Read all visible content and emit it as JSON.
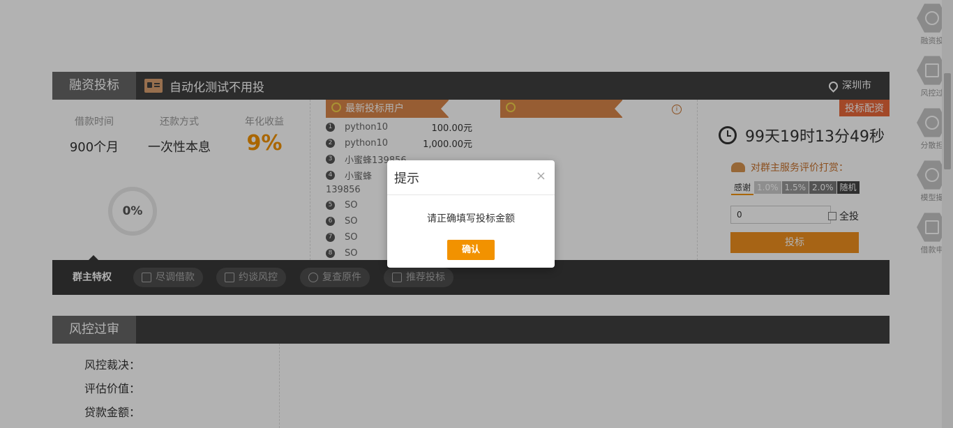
{
  "loan": {
    "tab": "融资投标",
    "title": "自动化测试不用投",
    "city": "深圳市",
    "term_label": "借款时间",
    "term_value": "900个月",
    "repay_label": "还款方式",
    "repay_value": "一次性本息",
    "rate_label": "年化收益",
    "rate_value": "9%",
    "progress": "0%",
    "progress_fraction": 0
  },
  "bidders": {
    "title": "最新投标用户",
    "rows": [
      {
        "n": "1",
        "name": "python10",
        "amount": "100.00元"
      },
      {
        "n": "2",
        "name": "python10",
        "amount": "1,000.00元"
      },
      {
        "n": "3",
        "name": "小蜜蜂139856",
        "amount": ""
      },
      {
        "n": "4",
        "name": "小蜜蜂",
        "amount": ""
      },
      {
        "n": "5",
        "name": "SO",
        "amount": ""
      },
      {
        "n": "6",
        "name": "SO",
        "amount": ""
      },
      {
        "n": "7",
        "name": "SO",
        "amount": ""
      },
      {
        "n": "8",
        "name": "SO",
        "amount": ""
      }
    ],
    "row4_wrap": "139856"
  },
  "invest": {
    "tag": "投标配资",
    "countdown": "99天19时13分49秒",
    "eval_text": "对群主服务评价打赏：",
    "rates": [
      "感谢",
      "1.0%",
      "1.5%",
      "2.0%",
      "随机"
    ],
    "amount_value": "0",
    "all_label": "全投",
    "bid_button": "投标"
  },
  "privileges": {
    "active": "群主特权",
    "items": [
      "尽调借款",
      "约谈风控",
      "复查原件",
      "推荐投标"
    ]
  },
  "risk": {
    "tab": "风控过审",
    "labels": [
      "风控裁决：",
      "评估价值：",
      "贷款金额："
    ]
  },
  "sidenav": [
    "融资投",
    "风控过",
    "分散担",
    "模型撮",
    "借款申"
  ],
  "modal": {
    "title": "提示",
    "close": "×",
    "message": "请正确填写投标金额",
    "confirm": "确认"
  },
  "colors": {
    "accent": "#f29200",
    "header": "#3f3f3f",
    "ribbon": "#d9864a"
  }
}
